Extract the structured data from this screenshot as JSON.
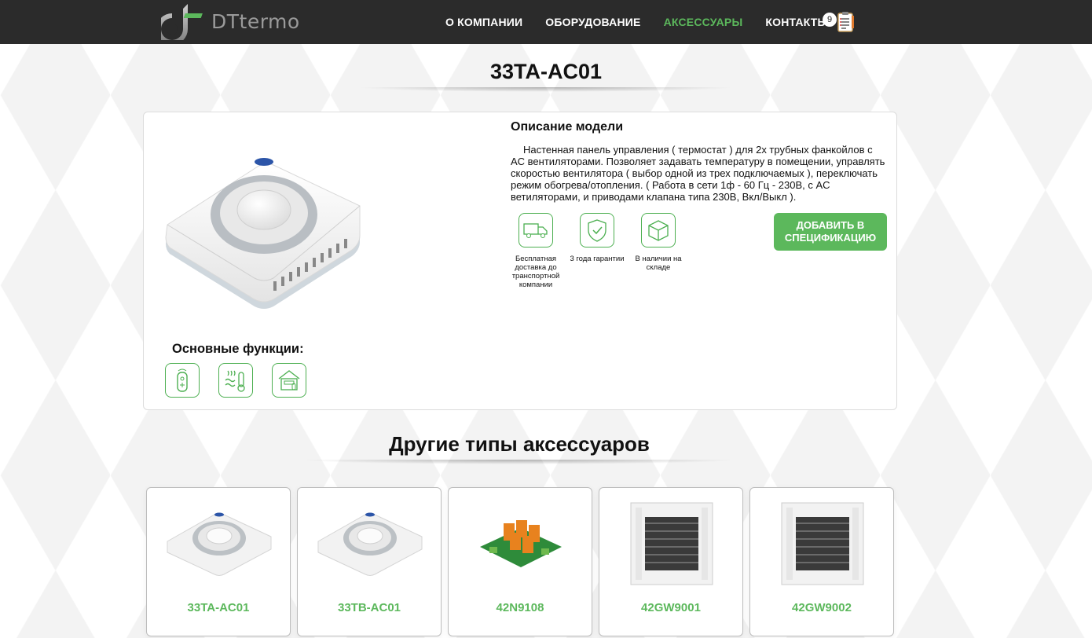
{
  "brand": {
    "name": "DTtermo"
  },
  "nav": {
    "items": [
      {
        "label": "О КОМПАНИИ",
        "active": false
      },
      {
        "label": "ОБОРУДОВАНИЕ",
        "active": false
      },
      {
        "label": "АКСЕССУАРЫ",
        "active": true
      },
      {
        "label": "КОНТАКТЫ",
        "active": false
      }
    ],
    "cart_count": "9"
  },
  "product": {
    "title": "33TA-AC01",
    "desc_title": "Описание модели",
    "description": "Настенная панель управления ( термостат ) для 2х трубных фанкойлов с AC вентиляторами. Позволяет задавать температуру в помещении, управлять скоростью вентилятора ( выбор одной из трех подключаемых ), переключать режим обогрева/отопления. ( Работа в сети 1ф - 60 Гц - 230В, с AC ветиляторами, и приводами клапана типа 230В, Вкл/Выкл ).",
    "features": [
      {
        "icon": "delivery-truck-icon",
        "label": "Бесплатная доставка до транспортной компании"
      },
      {
        "icon": "shield-guarantee-icon",
        "label": "3 года гарантии"
      },
      {
        "icon": "box-in-stock-icon",
        "label": "В наличии на складе"
      }
    ],
    "add_button": "ДОБАВИТЬ В СПЕЦИФИКАЦИЮ",
    "functions_title": "Основные функции:",
    "function_icons": [
      "remote-control-icon",
      "heating-thermometer-icon",
      "room-climate-icon"
    ]
  },
  "other": {
    "title": "Другие типы аксессуаров",
    "items": [
      {
        "name": "33TA-AC01",
        "image": "thermostat-panel"
      },
      {
        "name": "33TB-AC01",
        "image": "thermostat-panel"
      },
      {
        "name": "42N9108",
        "image": "relay-board"
      },
      {
        "name": "42GW9001",
        "image": "cassette-grille"
      },
      {
        "name": "42GW9002",
        "image": "cassette-grille"
      }
    ]
  },
  "colors": {
    "accent": "#5cb85c",
    "navbar": "#2b2b2b"
  }
}
